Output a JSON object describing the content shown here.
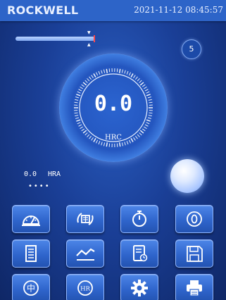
{
  "header": {
    "title": "ROCKWELL",
    "datetime": "2021-11-12 08:45:57"
  },
  "status": {
    "count_badge": "5"
  },
  "gauge": {
    "value": "0.0",
    "unit": "HRC"
  },
  "secondary": {
    "value": "0.0",
    "unit": "HRA",
    "dots": "••••"
  },
  "buttons": {
    "row1": [
      "hardness-tester-icon",
      "test-block-icon",
      "timer-icon",
      "zero-icon"
    ],
    "row2": [
      "report-icon",
      "trend-chart-icon",
      "schedule-document-icon",
      "save-icon"
    ],
    "row3_labels": {
      "language": "中",
      "hr": "HR"
    }
  },
  "colors": {
    "background": "#1a3f97",
    "topbar": "#2d64c8",
    "accent": "#cfe0ff",
    "marker": "#ff4a4a"
  }
}
